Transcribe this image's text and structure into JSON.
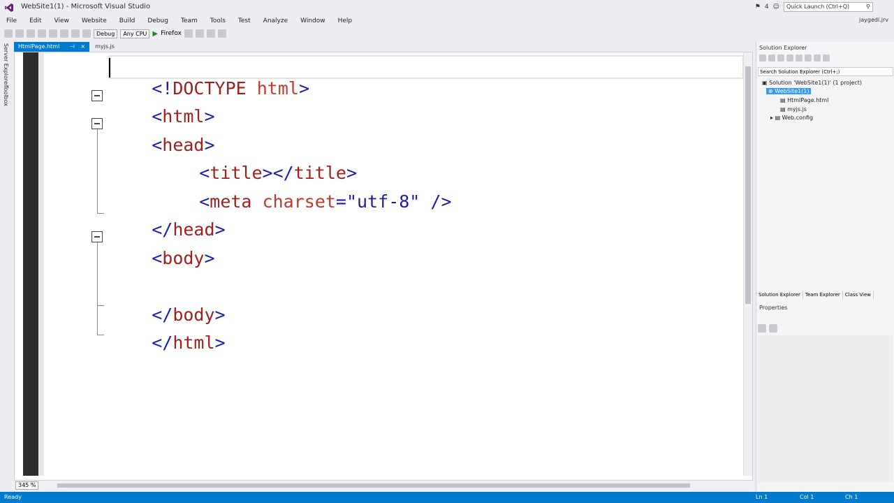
{
  "window": {
    "title": "WebSite1(1) - Microsoft Visual Studio",
    "quick_launch_placeholder": "Quick Launch (Ctrl+Q)",
    "notification_count": "4",
    "user": "jaygedi.jrv"
  },
  "menu": [
    "File",
    "Edit",
    "View",
    "Website",
    "Build",
    "Debug",
    "Team",
    "Tools",
    "Test",
    "Analyze",
    "Window",
    "Help"
  ],
  "toolbar": {
    "config": "Debug",
    "platform": "Any CPU",
    "run_target": "Firefox"
  },
  "left_strip": [
    "Server Explorer",
    "Toolbox"
  ],
  "tabs": [
    {
      "label": "HtmlPage.html",
      "close": "×",
      "active": true
    },
    {
      "label": "myjs.js",
      "active": false
    }
  ],
  "editor": {
    "lines": [
      "<!DOCTYPE html>",
      "<html>",
      "<head>",
      "    <title></title>",
      "    <meta charset=\"utf-8\" />",
      "</head>",
      "<body>",
      "",
      "</body>",
      "</html>"
    ],
    "zoom": "345 %"
  },
  "solution_explorer": {
    "title": "Solution Explorer",
    "search_placeholder": "Search Solution Explorer (Ctrl+;)",
    "tree": [
      {
        "label": "Solution 'WebSite1(1)' (1 project)",
        "level": 0
      },
      {
        "label": "WebSite1(1)",
        "level": 1,
        "selected": true
      },
      {
        "label": "HtmlPage.html",
        "level": 2
      },
      {
        "label": "myjs.js",
        "level": 2
      },
      {
        "label": "Web.config",
        "level": 2
      }
    ],
    "bottom_tabs": [
      "Solution Explorer",
      "Team Explorer",
      "Class View"
    ]
  },
  "properties": {
    "title": "Properties"
  },
  "status": {
    "left": "Ready",
    "ln": "Ln 1",
    "col": "Col 1",
    "ch": "Ch 1"
  },
  "colors": {
    "accent": "#007acc",
    "tag": "#a01f1f",
    "bracket": "#1c1cab"
  }
}
